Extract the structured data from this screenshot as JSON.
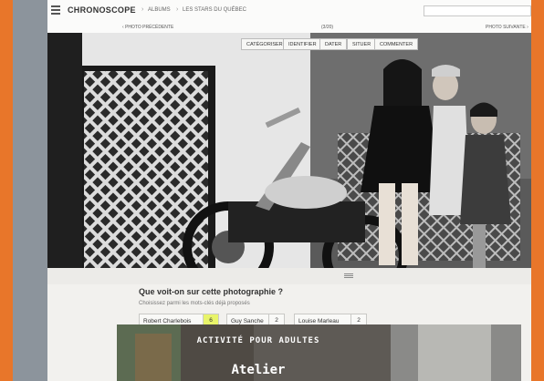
{
  "header": {
    "logo": "CHRONOSCOPE",
    "breadcrumb": [
      "ALBUMS",
      "LES STARS DU QUÉBEC"
    ],
    "search_placeholder": ""
  },
  "nav": {
    "prev_label": "PHOTO PRÉCÉDENTE",
    "counter": "(3/20)",
    "next_label": "PHOTO SUIVANTE"
  },
  "toolbar": [
    "CATÉGORISER",
    "IDENTIFIER",
    "DATER",
    "SITUER",
    "COMMENTER"
  ],
  "question": {
    "title": "Que voit-on sur cette photographie ?",
    "hint": "Choisissez parmi les mots-clés déjà proposés"
  },
  "tags": [
    {
      "label": "Robert Charlebois",
      "count": "6"
    },
    {
      "label": "Guy Sanche",
      "count": "2"
    },
    {
      "label": "Louise Marleau",
      "count": "2"
    }
  ],
  "promo": {
    "kicker": "ACTIVITÉ POUR ADULTES",
    "title": "Atelier"
  },
  "colors": {
    "frame": "#e8762a",
    "tag_highlight": "#e8f46a"
  }
}
